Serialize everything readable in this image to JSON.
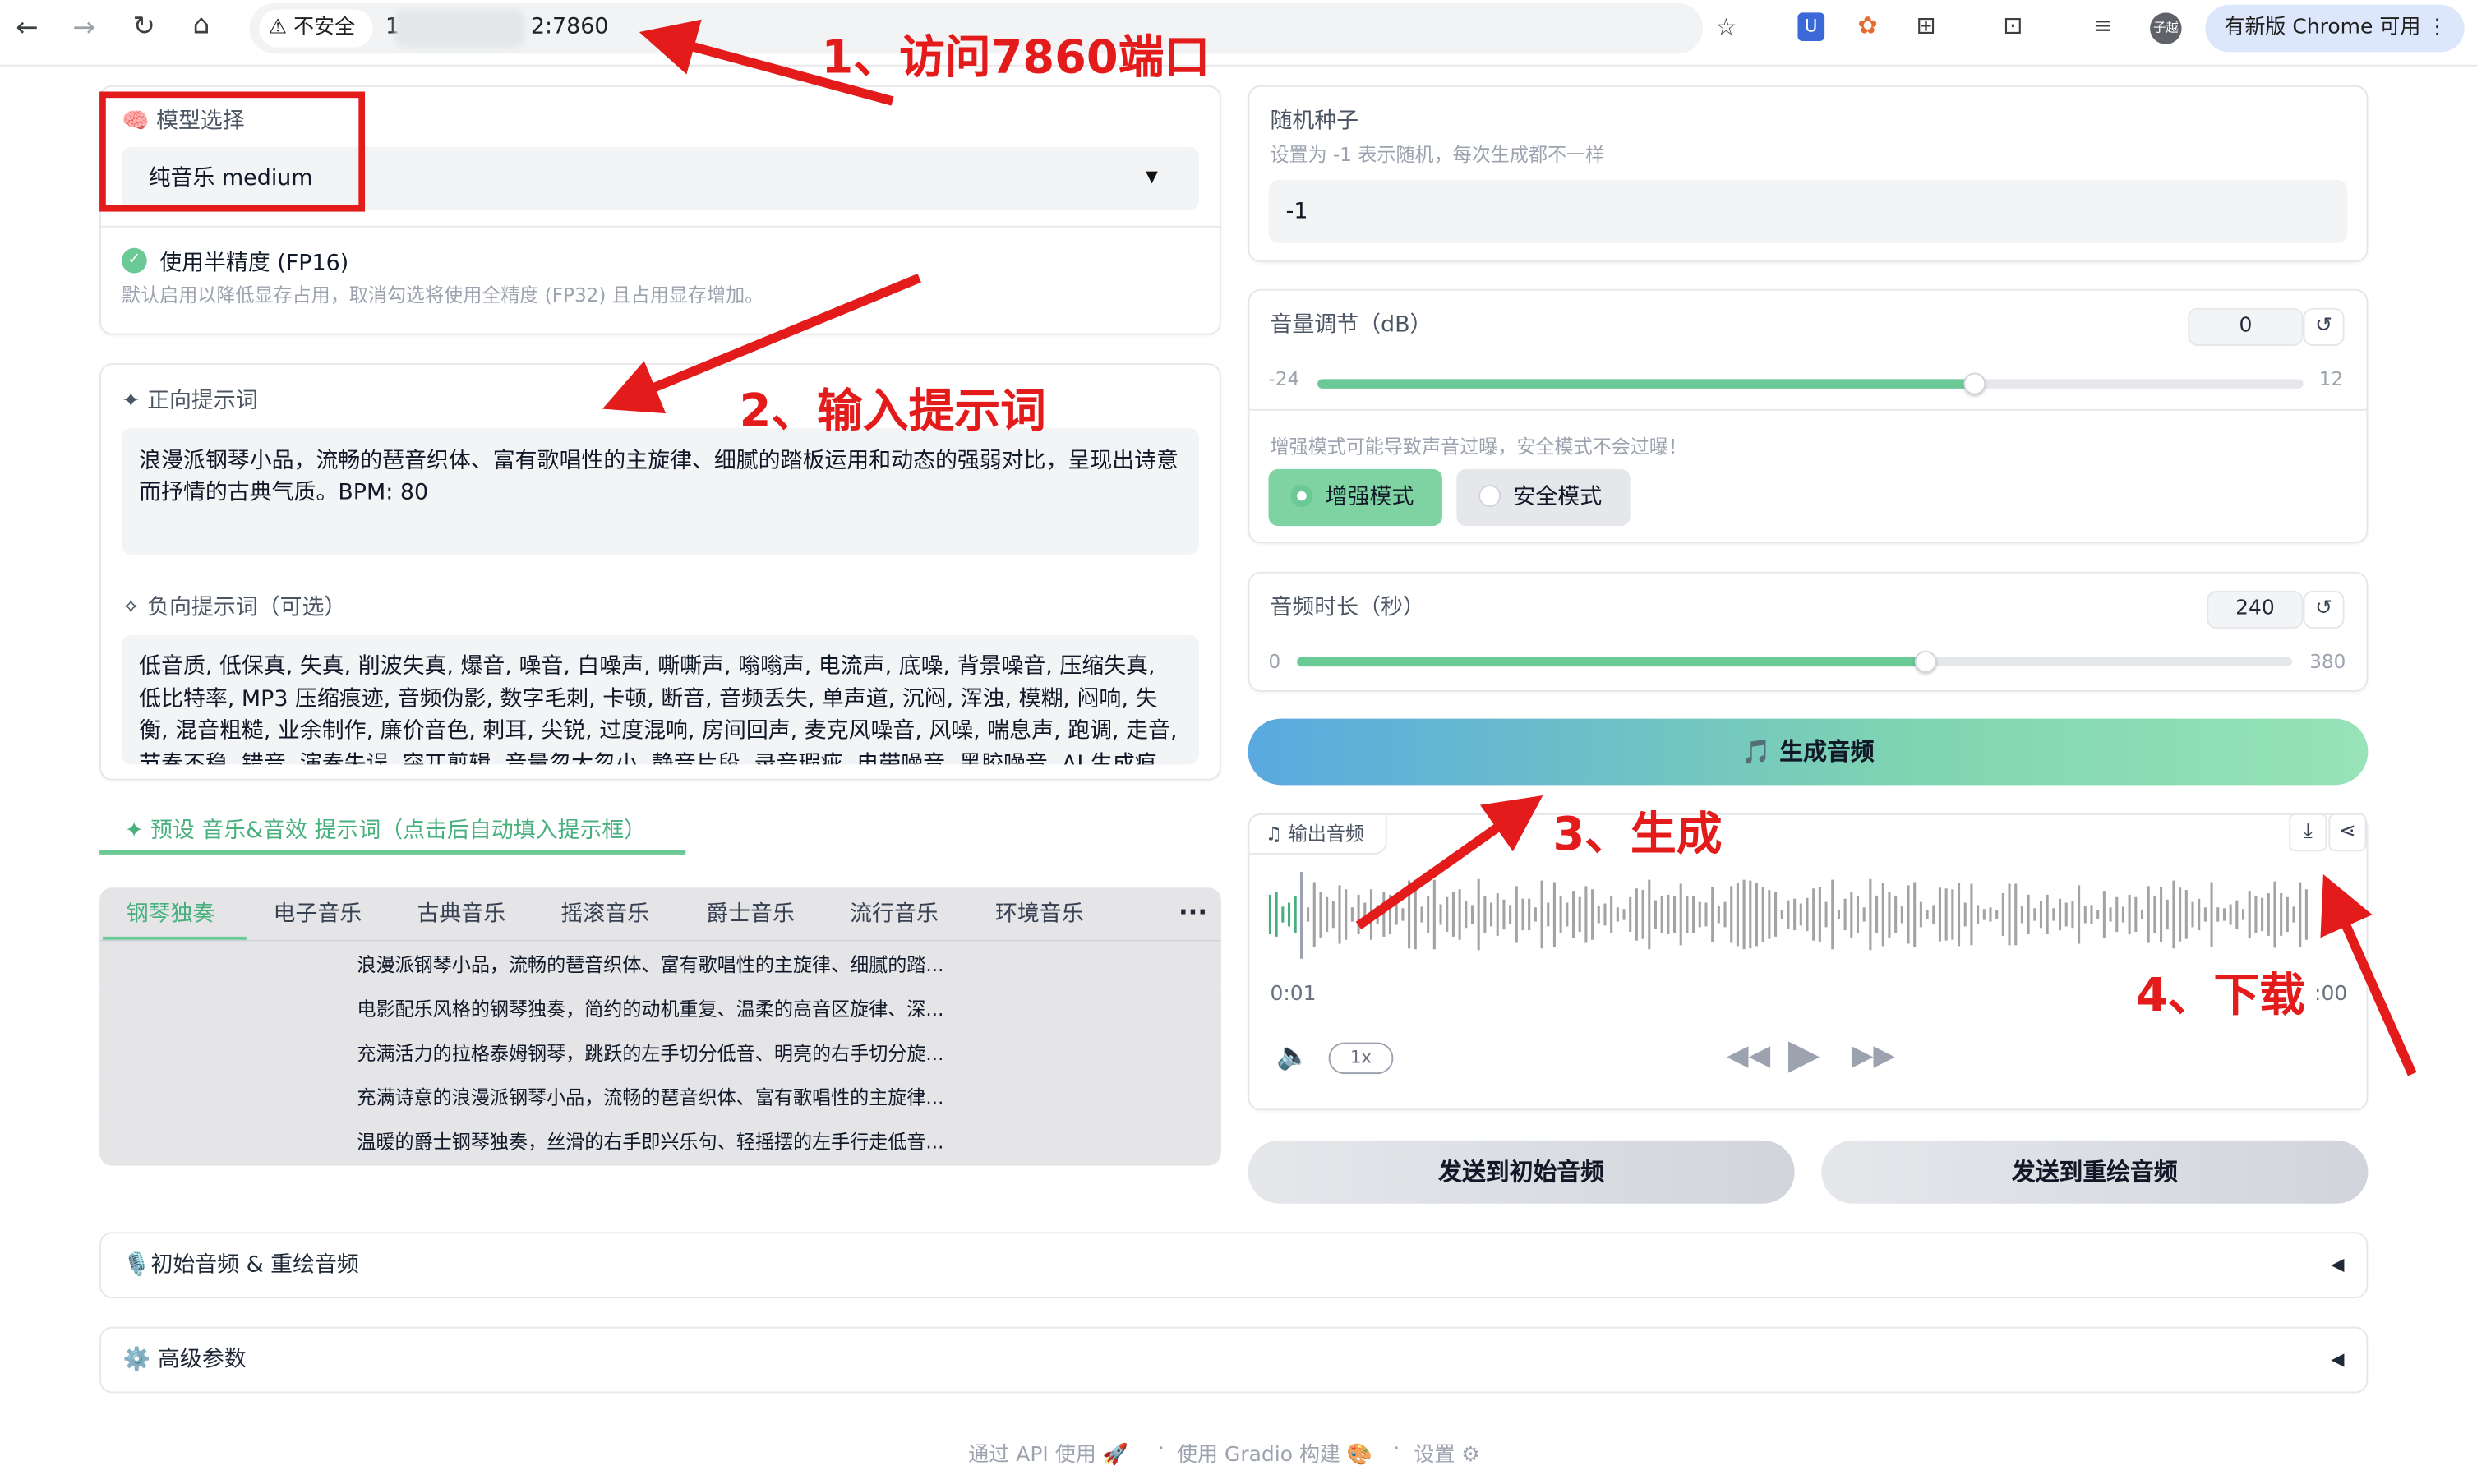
{
  "browser": {
    "security_label": "不安全",
    "url_prefix": "1",
    "url_suffix": "2:7860",
    "update_button": "有新版 Chrome 可用",
    "avatar_text": "子越"
  },
  "model_panel": {
    "label": "🧠 模型选择",
    "selected": "纯音乐 medium",
    "fp16_label": "使用半精度 (FP16)",
    "fp16_info": "默认启用以降低显存占用，取消勾选将使用全精度 (FP32) 且占用显存增加。",
    "fp16_checked": true
  },
  "prompt_panel": {
    "positive_label": "✦ 正向提示词",
    "positive_value": "浪漫派钢琴小品，流畅的琶音织体、富有歌唱性的主旋律、细腻的踏板运用和动态的强弱对比，呈现出诗意而抒情的古典气质。BPM: 80",
    "negative_label": "✧ 负向提示词（可选）",
    "negative_value": "低音质, 低保真, 失真, 削波失真, 爆音, 噪音, 白噪声, 嘶嘶声, 嗡嗡声, 电流声, 底噪, 背景噪音, 压缩失真, 低比特率, MP3 压缩痕迹, 音频伪影, 数字毛刺, 卡顿, 断音, 音频丢失, 单声道, 沉闷, 浑浊, 模糊, 闷响, 失衡, 混音粗糙, 业余制作, 廉价音色, 刺耳, 尖锐, 过度混响, 房间回声, 麦克风噪音, 风噪, 喘息声, 跑调, 走音, 节奏不稳, 错音, 演奏失误, 突兀剪辑, 音量忽大忽小, 静音片段, 录音瑕疵, 电带噪音, 黑胶噪音, AI 生成痕"
  },
  "presets": {
    "header": "✦ 预设 音乐&音效 提示词（点击后自动填入提示框）",
    "tabs": [
      "钢琴独奏",
      "电子音乐",
      "古典音乐",
      "摇滚音乐",
      "爵士音乐",
      "流行音乐",
      "环境音乐"
    ],
    "more": "···",
    "active_tab": 0,
    "items": [
      "浪漫派钢琴小品，流畅的琶音织体、富有歌唱性的主旋律、细腻的踏...",
      "电影配乐风格的钢琴独奏，简约的动机重复、温柔的高音区旋律、深...",
      "充满活力的拉格泰姆钢琴，跳跃的左手切分低音、明亮的右手切分旋...",
      "充满诗意的浪漫派钢琴小品，流畅的琶音织体、富有歌唱性的主旋律...",
      "温暖的爵士钢琴独奏，丝滑的右手即兴乐句、轻摇摆的左手行走低音..."
    ]
  },
  "seed_panel": {
    "label": "随机种子",
    "info": "设置为 -1 表示随机，每次生成都不一样",
    "value": "-1"
  },
  "volume_panel": {
    "label": "音量调节（dB）",
    "value": "0",
    "min": "-24",
    "max": "12",
    "fraction": 0.667,
    "warning": "增强模式可能导致声音过曝，安全模式不会过曝！",
    "mode_enhanced": "增强模式",
    "mode_safe": "安全模式",
    "selected_mode": "增强模式"
  },
  "duration_panel": {
    "label": "音频时长（秒）",
    "value": "240",
    "min": "0",
    "max": "380",
    "fraction": 0.632
  },
  "generate_button": "🎵 生成音频",
  "audio_output": {
    "label": "♫ 输出音频",
    "current_time": "0:01",
    "total_time": ":00",
    "speed": "1x"
  },
  "send_initial": "发送到初始音频",
  "send_repaint": "发送到重绘音频",
  "accordion_audio": "🎙️初始音频 & 重绘音频",
  "accordion_advanced": "⚙️ 高级参数",
  "footer": {
    "api": "通过 API 使用 🚀",
    "gradio": "使用 Gradio 构建 🎨",
    "settings": "设置 ⚙"
  },
  "annotations": {
    "step1": "1、访问7860端口",
    "step2": "2、输入提示词",
    "step3": "3、生成",
    "step4": "4、下载"
  },
  "colors": {
    "accent_green": "#6bc996",
    "annotation_red": "#e31b1b"
  }
}
